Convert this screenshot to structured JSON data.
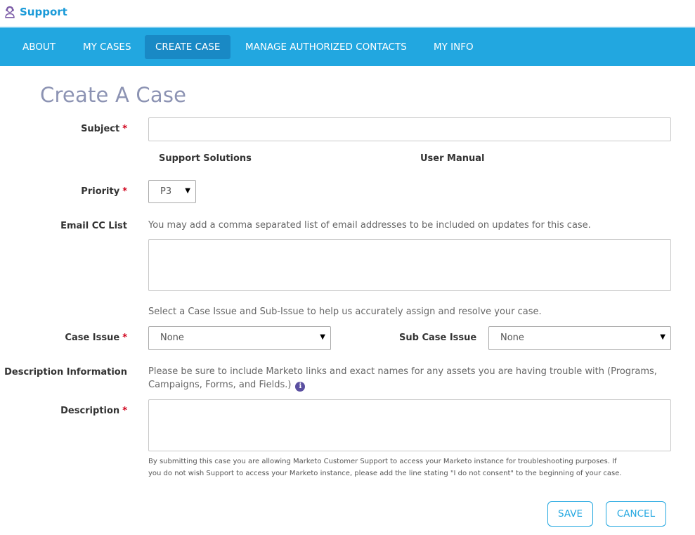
{
  "header": {
    "title": "Support",
    "icon": "support-agent-icon"
  },
  "nav": {
    "items": [
      {
        "label": "ABOUT"
      },
      {
        "label": "MY CASES"
      },
      {
        "label": "CREATE CASE",
        "active": true
      },
      {
        "label": "MANAGE AUTHORIZED CONTACTS"
      },
      {
        "label": "MY INFO"
      }
    ]
  },
  "page": {
    "title": "Create A Case"
  },
  "form": {
    "subject": {
      "label": "Subject",
      "required": "*",
      "value": ""
    },
    "links": {
      "support_solutions": "Support Solutions",
      "user_manual": "User Manual"
    },
    "priority": {
      "label": "Priority",
      "required": "*",
      "value": "P3"
    },
    "email_cc": {
      "label": "Email CC List",
      "help": "You may add a comma separated list of email addresses to be included on updates for this case.",
      "value": ""
    },
    "case_issue_help": "Select a Case Issue and Sub-Issue to help us accurately assign and resolve your case.",
    "case_issue": {
      "label": "Case Issue",
      "required": "*",
      "value": "None"
    },
    "sub_case_issue": {
      "label": "Sub Case Issue",
      "value": "None"
    },
    "description_info": {
      "label": "Description Information",
      "line1": "Please be sure to include Marketo links and exact names for any assets you are having trouble with (Programs,",
      "line2": "Campaigns, Forms, and Fields.)",
      "icon": "info-icon"
    },
    "description": {
      "label": "Description",
      "required": "*",
      "value": ""
    },
    "consent_line1": "By submitting this case you are allowing Marketo Customer Support to access your Marketo instance for troubleshooting purposes. If",
    "consent_line2": "you do not wish Support to access your Marketo instance, please add the line stating \"I do not consent\" to the beginning of your case."
  },
  "actions": {
    "save_label": "SAVE",
    "cancel_label": "CANCEL"
  },
  "colors": {
    "nav_bg": "#22a7e0",
    "nav_active_bg": "#1989c5",
    "brand": "#1a9ad8",
    "required": "#d0021b",
    "title": "#8c93b3"
  }
}
